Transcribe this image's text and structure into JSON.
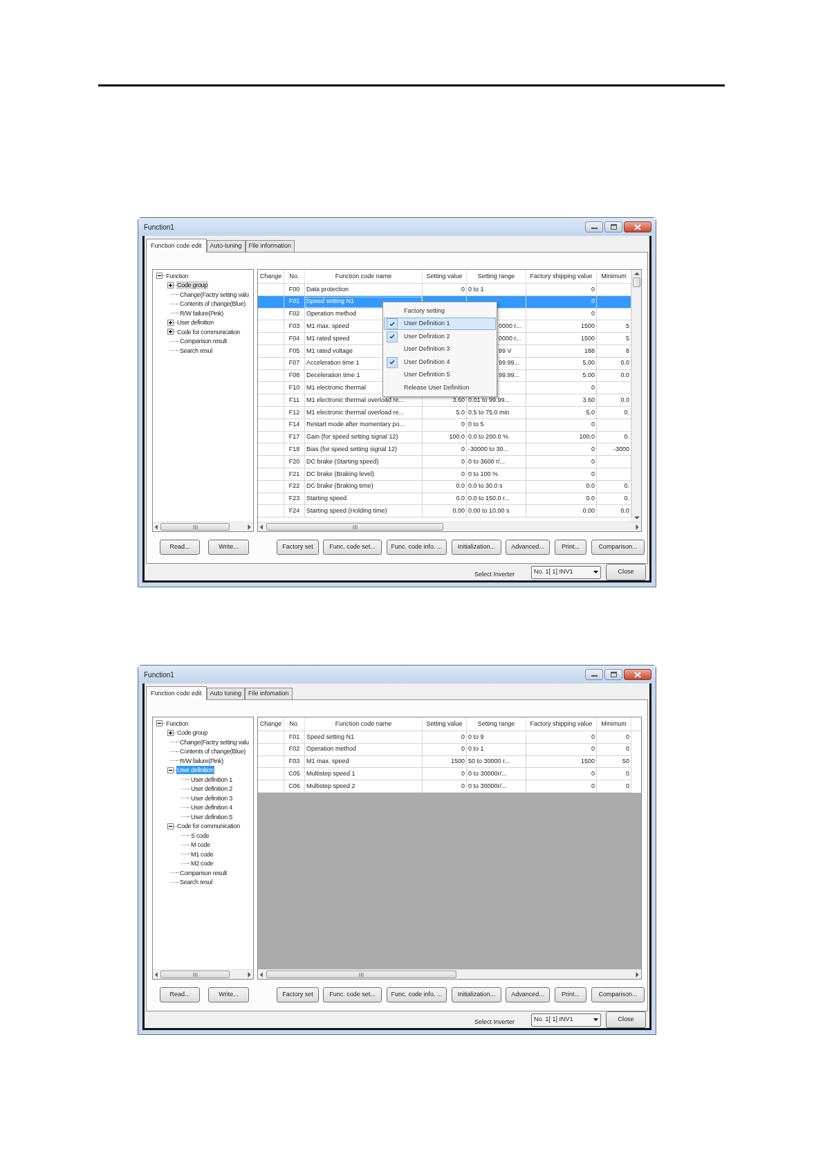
{
  "windows": [
    {
      "title": "Function1",
      "tabs": [
        {
          "label": "Function code edit",
          "selected": true
        },
        {
          "label": "Auto-tuning",
          "selected": false
        },
        {
          "label": "File information",
          "selected": false
        }
      ],
      "tree": {
        "focused": false,
        "items": [
          {
            "label": "Function",
            "kind": "folder",
            "expanded": true,
            "selected": false,
            "children": [
              {
                "label": "Code group",
                "kind": "folder",
                "expanded": false,
                "selected": true
              },
              {
                "label": "Change(Factry setting valu",
                "kind": "leaf",
                "selected": false
              },
              {
                "label": "Contents of change(Blue)",
                "kind": "leaf",
                "selected": false
              },
              {
                "label": "R/W failure(Pink)",
                "kind": "leaf",
                "selected": false
              },
              {
                "label": "User definition",
                "kind": "folder",
                "expanded": false,
                "selected": false
              },
              {
                "label": "Code for communication",
                "kind": "folder",
                "expanded": false,
                "selected": false
              },
              {
                "label": "Comparison result",
                "kind": "leaf",
                "selected": false
              },
              {
                "label": "Search resul",
                "kind": "leaf",
                "selected": false
              }
            ]
          }
        ]
      },
      "table": {
        "columns": [
          "Change",
          "No.",
          "Function code name",
          "Setting value",
          "Setting range",
          "Factory shipping value",
          "Minimum"
        ],
        "rows": [
          {
            "no": "F00",
            "name": "Data protection",
            "value": "0",
            "range": "0 to 1",
            "factory": "0",
            "selected": false
          },
          {
            "no": "F01",
            "name": "Speed setting N1",
            "factory": "0",
            "selected": true
          },
          {
            "no": "F02",
            "name": "Operation method",
            "factory": "0",
            "selected": false
          },
          {
            "no": "F03",
            "name": "M1 max. speed",
            "range_tail": "0000 r...",
            "factory": "1500",
            "minimum": "5",
            "selected": false
          },
          {
            "no": "F04",
            "name": "M1 rated speed",
            "range_tail": "0000 r...",
            "factory": "1500",
            "minimum": "5",
            "selected": false
          },
          {
            "no": "F05",
            "name": "M1 rated voltage",
            "range_tail": "99 V",
            "factory": "188",
            "minimum": "8",
            "selected": false
          },
          {
            "no": "F07",
            "name": "Acceleration time 1",
            "range_tail": "99.99...",
            "factory": "5.00",
            "minimum": "0.0",
            "selected": false
          },
          {
            "no": "F08",
            "name": "Deceleration time 1",
            "range_tail": "99.99...",
            "factory": "5.00",
            "minimum": "0.0",
            "selected": false
          },
          {
            "no": "F10",
            "name": "M1 electronic thermal",
            "factory": "0",
            "selected": false
          },
          {
            "no": "F11",
            "name": "M1 electronic thermal overload re...",
            "value": "3.60",
            "range": "0.01 to 99.99...",
            "factory": "3.60",
            "minimum": "0.0",
            "selected": false
          },
          {
            "no": "F12",
            "name": "M1 electronic thermal overload re...",
            "value": "5.0",
            "range": "0.5 to 75.0 min",
            "factory": "5.0",
            "minimum": "0.",
            "selected": false
          },
          {
            "no": "F14",
            "name": "Restart mode after momentary po...",
            "value": "0",
            "range": "0 to 5",
            "factory": "0",
            "selected": false
          },
          {
            "no": "F17",
            "name": "Gain (for speed setting signal 12)",
            "value": "100.0",
            "range": "0.0 to 200.0 %",
            "factory": "100.0",
            "minimum": "0.",
            "selected": false
          },
          {
            "no": "F18",
            "name": "Bias (for speed setting signal 12)",
            "value": "0",
            "range": "-30000 to 30...",
            "factory": "0",
            "minimum": "-3000",
            "selected": false
          },
          {
            "no": "F20",
            "name": "DC brake (Starting speed)",
            "value": "0",
            "range": "0 to 3600 r/...",
            "factory": "0",
            "selected": false
          },
          {
            "no": "F21",
            "name": "DC brake (Braking level)",
            "value": "0",
            "range": "0 to 100 %",
            "factory": "0",
            "selected": false
          },
          {
            "no": "F22",
            "name": "DC brake (Braking time)",
            "value": "0.0",
            "range": "0.0 to 30.0 s",
            "factory": "0.0",
            "minimum": "0.",
            "selected": false
          },
          {
            "no": "F23",
            "name": "Starting speed",
            "value": "0.0",
            "range": "0.0 to 150.0 r...",
            "factory": "0.0",
            "minimum": "0.",
            "selected": false
          },
          {
            "no": "F24",
            "name": "Starting speed (Holding time)",
            "value": "0.00",
            "range": "0.00 to 10.00 s",
            "factory": "0.00",
            "minimum": "0.0",
            "selected": false
          }
        ],
        "menu": [
          {
            "label": "Factory setting",
            "checked": false,
            "selected": false
          },
          {
            "label": "User Definition 1",
            "checked": true,
            "selected": true
          },
          {
            "label": "User Definition 2",
            "checked": true,
            "selected": false
          },
          {
            "label": "User Definition 3",
            "checked": false,
            "selected": false
          },
          {
            "label": "User Definition 4",
            "checked": true,
            "selected": false
          },
          {
            "label": "User Definition 5",
            "checked": false,
            "selected": false
          },
          {
            "label": "Release User Definition",
            "checked": false,
            "selected": false
          }
        ]
      },
      "buttons": [
        "Read...",
        "Write...",
        "Factory set",
        "Func. code set...",
        "Func. code info. ...",
        "Initialization...",
        "Advanced...",
        "Print...",
        "Comparison..."
      ],
      "status": {
        "label": "Select Inverter",
        "inverter": "No. 1[ 1] INV1",
        "close": "Close"
      }
    },
    {
      "title": "Function1",
      "tabs": [
        {
          "label": "Function code edit",
          "selected": true
        },
        {
          "label": "Auto tuning",
          "selected": false
        },
        {
          "label": "File infomation",
          "selected": false
        }
      ],
      "tree": {
        "focused": true,
        "items": [
          {
            "label": "Function",
            "kind": "folder",
            "expanded": true,
            "selected": false,
            "children": [
              {
                "label": "Code group",
                "kind": "folder",
                "expanded": false,
                "selected": false
              },
              {
                "label": "Change(Factry setting valu",
                "kind": "leaf",
                "selected": false
              },
              {
                "label": "Contents of change(Blue)",
                "kind": "leaf",
                "selected": false
              },
              {
                "label": "R/W failure(Pink)",
                "kind": "leaf",
                "selected": false
              },
              {
                "label": "User definition",
                "kind": "folder",
                "expanded": true,
                "selected": true,
                "children": [
                  {
                    "label": "User definition 1",
                    "kind": "leaf",
                    "selected": false
                  },
                  {
                    "label": "User definition 2",
                    "kind": "leaf",
                    "selected": false
                  },
                  {
                    "label": "User definition 3",
                    "kind": "leaf",
                    "selected": false
                  },
                  {
                    "label": "User definition 4",
                    "kind": "leaf",
                    "selected": false
                  },
                  {
                    "label": "User definition 5",
                    "kind": "leaf",
                    "selected": false
                  }
                ]
              },
              {
                "label": "Code for communication",
                "kind": "folder",
                "expanded": true,
                "selected": false,
                "children": [
                  {
                    "label": "S code",
                    "kind": "leaf",
                    "selected": false
                  },
                  {
                    "label": "M code",
                    "kind": "leaf",
                    "selected": false
                  },
                  {
                    "label": "M1 code",
                    "kind": "leaf",
                    "selected": false
                  },
                  {
                    "label": "M2 code",
                    "kind": "leaf",
                    "selected": false
                  }
                ]
              },
              {
                "label": "Comparison result",
                "kind": "leaf",
                "selected": false
              },
              {
                "label": "Search resul",
                "kind": "leaf",
                "selected": false
              }
            ]
          }
        ]
      },
      "table": {
        "columns": [
          "Change",
          "No.",
          "Function code name",
          "Setting value",
          "Setting range",
          "Factory shipping value",
          "Minimum"
        ],
        "rows": [
          {
            "no": "F01",
            "name": "Speed setting N1",
            "value": "0",
            "range": "0 to 9",
            "factory": "0",
            "minimum": "0",
            "selected": false
          },
          {
            "no": "F02",
            "name": "Operation method",
            "value": "0",
            "range": "0 to 1",
            "factory": "0",
            "minimum": "0",
            "selected": false
          },
          {
            "no": "F03",
            "name": "M1 max. speed",
            "value": "1500",
            "range": "50 to 30000 r...",
            "factory": "1500",
            "minimum": "50",
            "selected": false
          },
          {
            "no": "C05",
            "name": "Multistep speed 1",
            "value": "0",
            "range": "0 to 30000r/...",
            "factory": "0",
            "minimum": "0",
            "selected": false
          },
          {
            "no": "C06",
            "name": "Multistep speed 2",
            "value": "0",
            "range": "0 to 30000r/...",
            "factory": "0",
            "minimum": "0",
            "selected": false
          }
        ]
      },
      "buttons": [
        "Read...",
        "Write...",
        "Factory set",
        "Func. code set...",
        "Func. code info. ...",
        "Initialization...",
        "Advanced...",
        "Print...",
        "Comparison..."
      ],
      "status": {
        "label": "Select Inverter",
        "inverter": "No. 1[ 1] INV1",
        "close": "Close"
      }
    }
  ]
}
